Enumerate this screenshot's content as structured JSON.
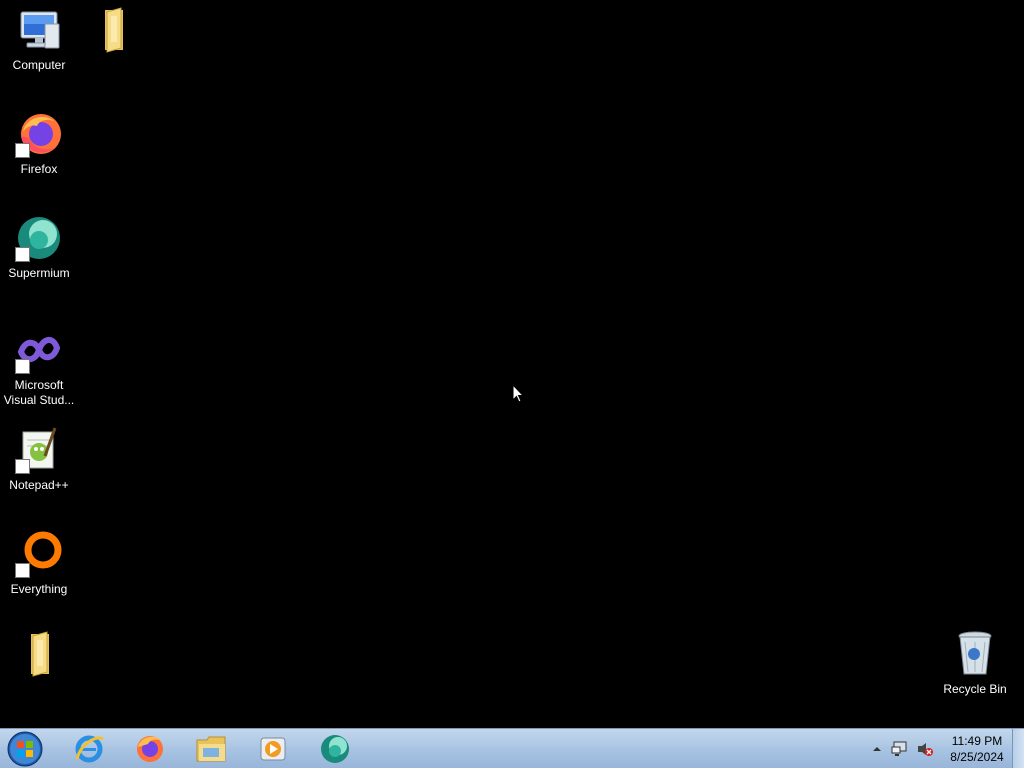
{
  "desktop": {
    "icons": [
      {
        "label": "Computer",
        "icon": "computer-icon",
        "shortcut": false
      },
      {
        "label": "",
        "icon": "folder-icon",
        "shortcut": false
      },
      {
        "label": "Firefox",
        "icon": "firefox-icon",
        "shortcut": true
      },
      {
        "label": "Supermium",
        "icon": "supermium-icon",
        "shortcut": true
      },
      {
        "label": "Microsoft Visual Stud...",
        "icon": "visual-studio-icon",
        "shortcut": true
      },
      {
        "label": "Notepad++",
        "icon": "notepadplusplus-icon",
        "shortcut": true
      },
      {
        "label": "Everything",
        "icon": "everything-icon",
        "shortcut": true
      },
      {
        "label": "",
        "icon": "folder-icon",
        "shortcut": false
      },
      {
        "label": "Recycle Bin",
        "icon": "recycle-bin-icon",
        "shortcut": false
      }
    ]
  },
  "taskbar": {
    "start": "start-orb-icon",
    "pinned": [
      {
        "icon": "internet-explorer-icon"
      },
      {
        "icon": "firefox-icon"
      },
      {
        "icon": "file-explorer-icon"
      },
      {
        "icon": "media-player-icon"
      },
      {
        "icon": "supermium-icon"
      }
    ],
    "tray": {
      "icons": [
        "show-hidden-icons-chevron",
        "network-icon",
        "volume-muted-icon"
      ],
      "time": "11:49 PM",
      "date": "8/25/2024"
    }
  },
  "colors": {
    "desktop_bg": "#000000",
    "taskbar_bg": "#a9c4e3"
  }
}
